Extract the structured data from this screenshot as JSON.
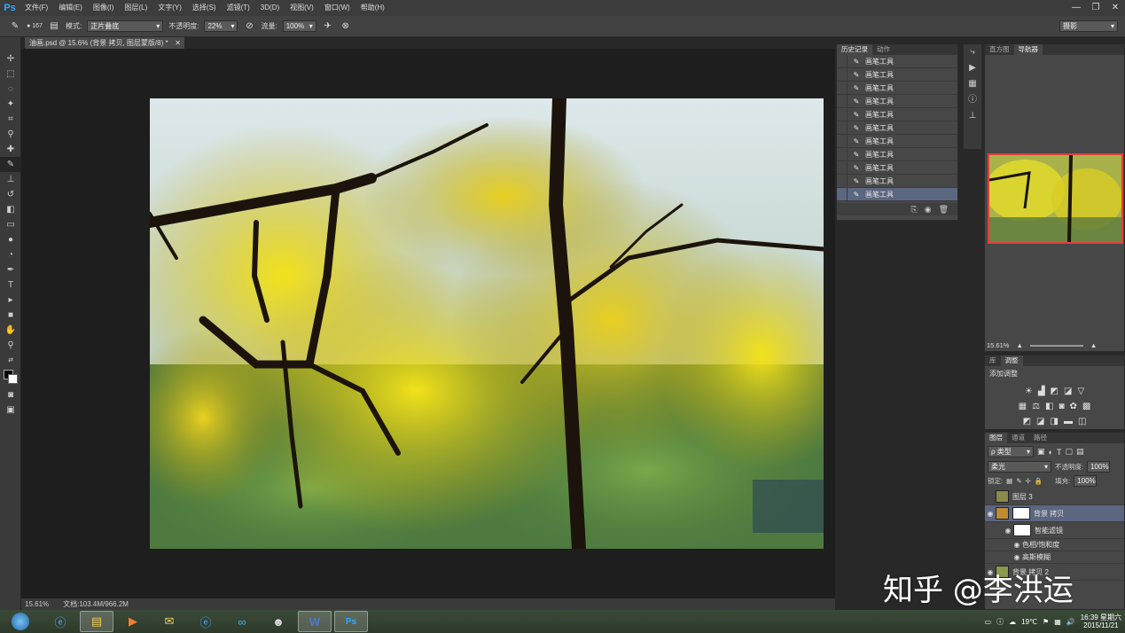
{
  "app": {
    "logo": "Ps"
  },
  "menu": [
    "文件(F)",
    "编辑(E)",
    "图像(I)",
    "图层(L)",
    "文字(Y)",
    "选择(S)",
    "滤镜(T)",
    "3D(D)",
    "视图(V)",
    "窗口(W)",
    "帮助(H)"
  ],
  "window_controls": [
    "—",
    "❐",
    "✕"
  ],
  "options": {
    "brush_size": "167",
    "mode_label": "模式:",
    "mode_value": "正片叠底",
    "opacity_label": "不透明度:",
    "opacity_value": "22%",
    "flow_label": "流量:",
    "flow_value": "100%",
    "workspace": "摄影"
  },
  "document": {
    "tab": "油画.psd @ 15.6% (背景 拷贝, 图层蒙版/8) *",
    "zoom": "15.61%",
    "doc_size": "文档:103.4M/966.2M"
  },
  "history": {
    "tabs": [
      "历史记录",
      "动作"
    ],
    "items": [
      "画笔工具",
      "画笔工具",
      "画笔工具",
      "画笔工具",
      "画笔工具",
      "画笔工具",
      "画笔工具",
      "画笔工具",
      "画笔工具",
      "画笔工具",
      "画笔工具"
    ],
    "selected_index": 10
  },
  "navigator": {
    "tabs": [
      "直方图",
      "导航器"
    ],
    "zoom": "15.61%"
  },
  "adjustments": {
    "tabs": [
      "库",
      "调整"
    ],
    "title": "添加调整"
  },
  "layers": {
    "tabs": [
      "图层",
      "通道",
      "路径"
    ],
    "filter_label": "ρ 类型",
    "blend_mode": "柔光",
    "opacity_label": "不透明度:",
    "opacity_value": "100%",
    "lock_label": "锁定:",
    "fill_label": "填充:",
    "fill_value": "100%",
    "rows": [
      {
        "name": "图层 3"
      },
      {
        "name": "背景 拷贝"
      },
      {
        "name": "智能滤镜"
      },
      {
        "name": "色相/饱和度"
      },
      {
        "name": "高斯模糊"
      },
      {
        "name": "背景 拷贝 2"
      }
    ]
  },
  "taskbar": {
    "weather": "19℃",
    "time": "16:39",
    "weekday": "星期六",
    "date": "2015/11/21"
  },
  "watermark": "知乎 @李洪运",
  "colors": {
    "accent": "#31a8ff",
    "selected_row": "#5b6680",
    "nav_frame": "#e0403a"
  }
}
